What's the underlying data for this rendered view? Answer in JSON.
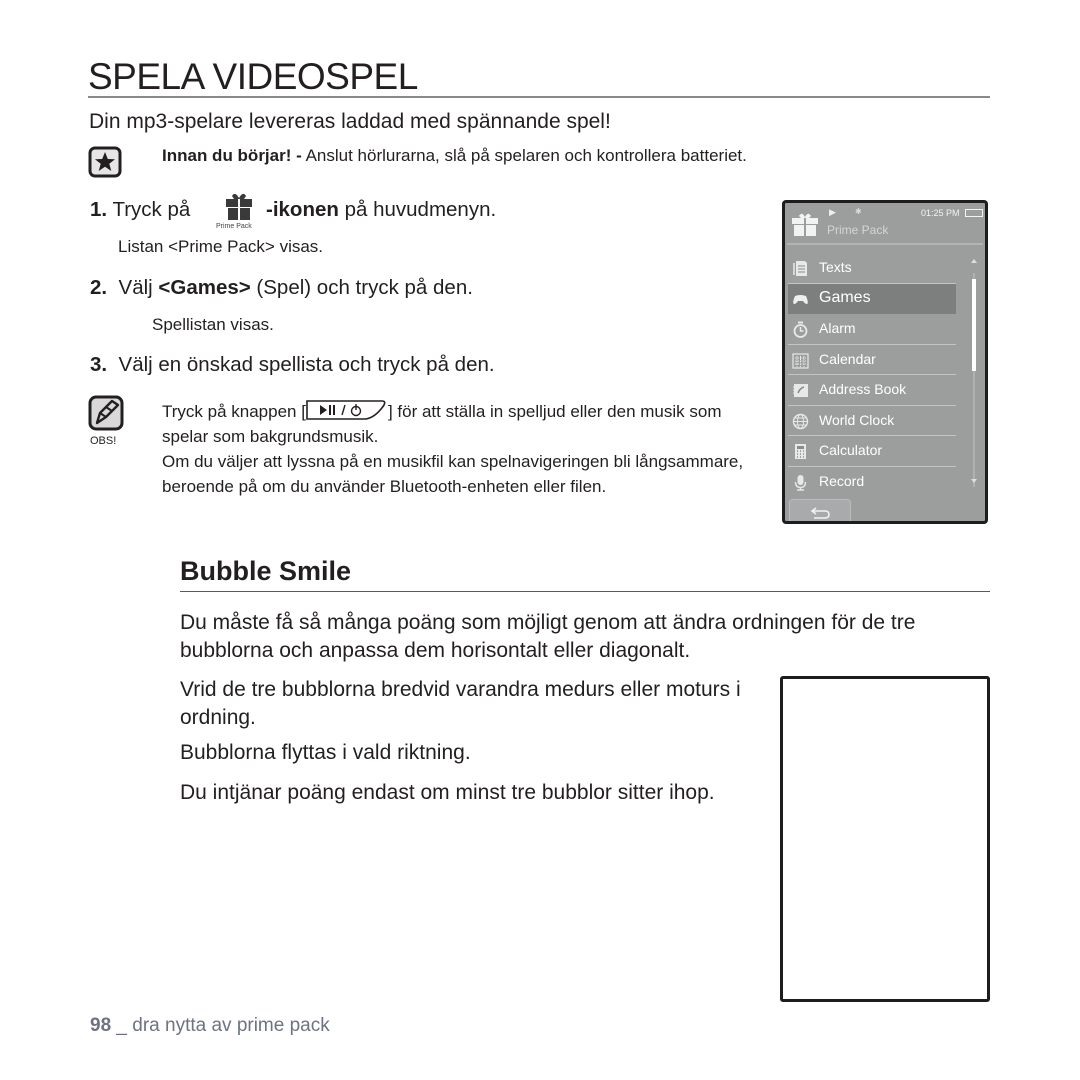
{
  "page": {
    "title": "SPELA VIDEOSPEL",
    "intro": "Din mp3-spelare levereras laddad med spännande spel!",
    "note": {
      "icon": "star-note-icon",
      "bold": "Innan du börjar! -",
      "text": " Anslut hörlurarna, slå på spelaren och kontrollera batteriet."
    },
    "steps": [
      {
        "num": "1.",
        "text_before": "Tryck på",
        "icon": "prime-pack-icon",
        "icon_label": "Prime Pack",
        "bold": "-ikonen",
        "text_after": " på huvudmenyn.",
        "sub": "Listan <Prime Pack> visas."
      },
      {
        "num": "2.",
        "text_before": "Välj ",
        "bold": "<Games>",
        "text_after": " (Spel) och tryck på den.",
        "sub": "Spellistan visas."
      },
      {
        "num": "3.",
        "text": "Välj en önskad spellista och tryck på den."
      }
    ],
    "obs": {
      "label": "OBS!",
      "icon": "pencil-note-icon",
      "line1_before": "Tryck på knappen [",
      "button_glyph": "▶II / ⏻",
      "line1_after": "] för att ställa in spelljud eller den musik som spelar som bakgrundsmusik.",
      "line2": "Om du väljer att lyssna på en musikfil kan spelnavigeringen bli långsammare, beroende på om du använder Bluetooth-enheten eller filen."
    },
    "section": {
      "title": "Bubble Smile",
      "p1": "Du måste få så många poäng som möjligt genom att ändra ordningen för de tre bubblorna och anpassa dem horisontalt eller diagonalt.",
      "p2": "Vrid de tre bubblorna bredvid varandra medurs eller moturs i ordning.",
      "p3": "Bubblorna flyttas i vald riktning.",
      "p4": "Du intjänar poäng endast om minst tre bubblor sitter ihop."
    },
    "footer": {
      "page_number": "98",
      "separator": " _ ",
      "text": "dra nytta av prime pack"
    }
  },
  "device": {
    "status": {
      "play_glyph": "▶",
      "bt_glyph": "✱",
      "time": "01:25 PM"
    },
    "title": "Prime Pack",
    "items": [
      {
        "label": "Texts",
        "icon": "document-icon"
      },
      {
        "label": "Games",
        "icon": "gamepad-icon",
        "selected": true
      },
      {
        "label": "Alarm",
        "icon": "stopwatch-icon"
      },
      {
        "label": "Calendar",
        "icon": "calendar-icon"
      },
      {
        "label": "Address Book",
        "icon": "address-book-icon"
      },
      {
        "label": "World Clock",
        "icon": "globe-icon"
      },
      {
        "label": "Calculator",
        "icon": "calculator-icon"
      },
      {
        "label": "Record",
        "icon": "microphone-icon"
      }
    ],
    "colors": {
      "screen_bg": "#9c9d9d",
      "selected_bg": "#7d7e7e",
      "text": "#ffffff"
    }
  }
}
